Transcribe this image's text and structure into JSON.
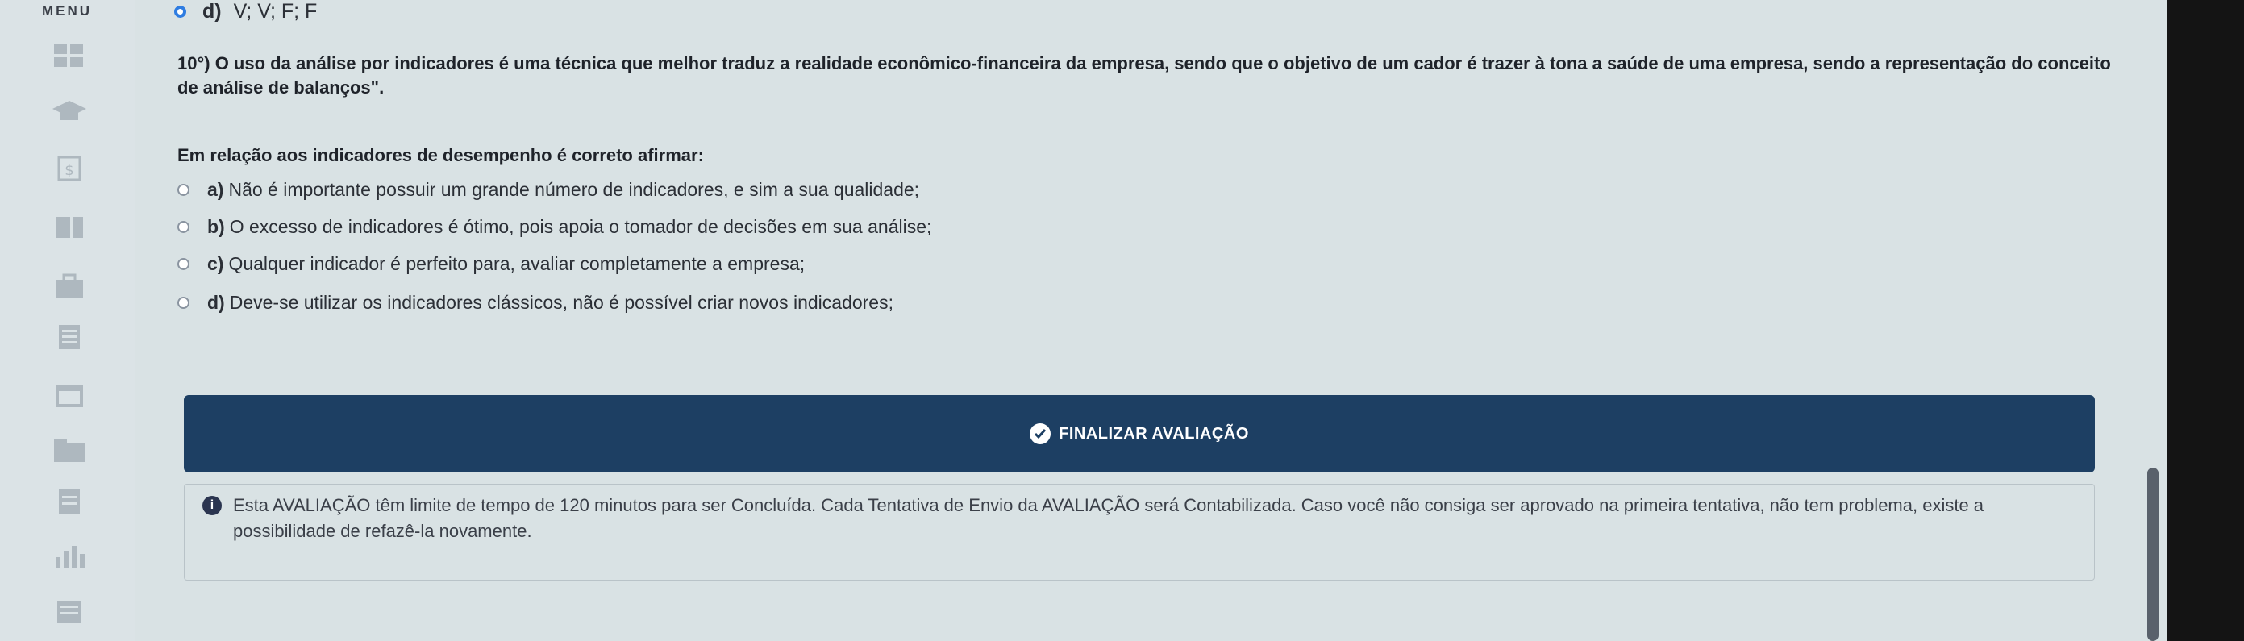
{
  "sidebar": {
    "menu_label": "MENU",
    "icons": [
      "dashboard-icon",
      "graduation-cap-icon",
      "dollar-icon",
      "book-icon",
      "briefcase-icon",
      "document-icon",
      "calendar-icon",
      "folder-icon",
      "notes-icon",
      "chart-icon",
      "list-icon"
    ]
  },
  "previous_answer": {
    "letter": "d)",
    "text": "V; V; F; F"
  },
  "question": {
    "text": "10°) O uso da análise por indicadores é uma técnica que melhor traduz a realidade econômico-financeira da empresa, sendo que o objetivo de um cador é trazer à tona a saúde de uma empresa, sendo a representação do conceito de análise de balanços\".",
    "prompt": "Em relação aos indicadores de desempenho é correto afirmar:"
  },
  "options": [
    {
      "letter": "a)",
      "text": "Não é importante possuir um grande número de indicadores, e sim a sua qualidade;"
    },
    {
      "letter": "b)",
      "text": "O excesso de indicadores é ótimo, pois apoia o tomador de decisões em sua análise;"
    },
    {
      "letter": "c)",
      "text": "Qualquer indicador é perfeito para, avaliar completamente a empresa;"
    },
    {
      "letter": "d)",
      "text": "Deve-se utilizar os indicadores clássicos, não é possível criar novos indicadores;"
    }
  ],
  "finalize_button": {
    "label": "FINALIZAR AVALIAÇÃO"
  },
  "notice": {
    "text": "Esta AVALIAÇÃO têm limite de tempo de 120 minutos para ser Concluída. Cada Tentativa de Envio da AVALIAÇÃO será Contabilizada. Caso você não consiga ser aprovado na primeira tentativa, não tem problema, existe a possibilidade de refazê-la novamente."
  },
  "colors": {
    "finalize_bg": "#1d3f63",
    "selected_radio": "#2f7de1"
  }
}
